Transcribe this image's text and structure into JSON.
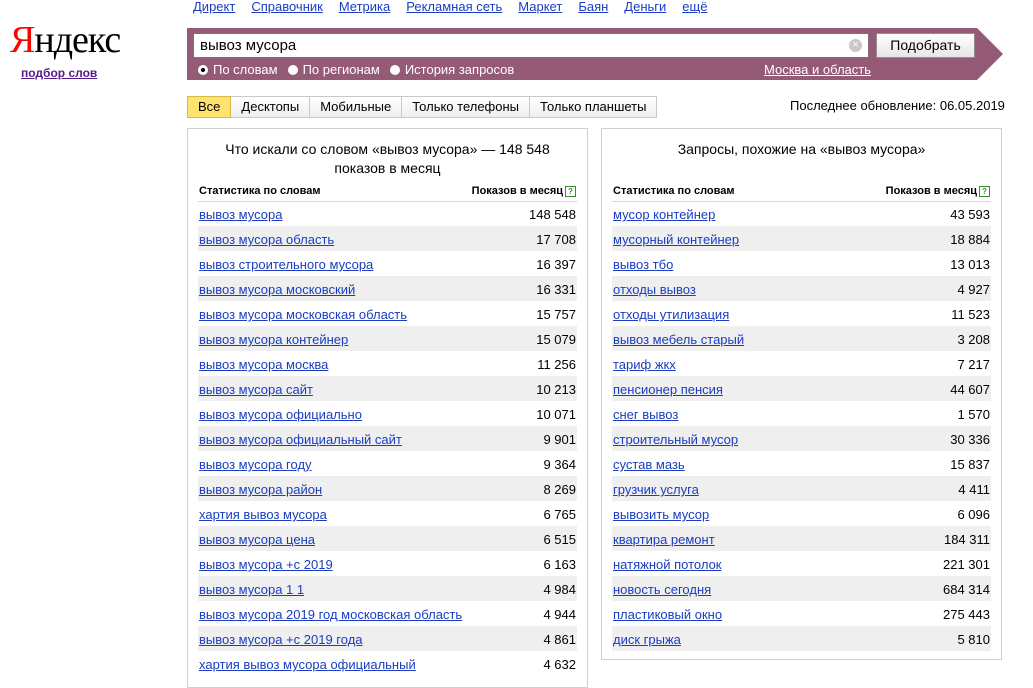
{
  "logo": {
    "first": "Я",
    "rest": "ндекс",
    "sub": "подбор слов"
  },
  "topnav": [
    "Директ",
    "Справочник",
    "Метрика",
    "Рекламная сеть",
    "Маркет",
    "Баян",
    "Деньги",
    "ещё"
  ],
  "search": {
    "value": "вывоз мусора",
    "button": "Подобрать",
    "clear_icon": "×"
  },
  "radios": [
    {
      "label": "По словам",
      "checked": true
    },
    {
      "label": "По регионам",
      "checked": false
    },
    {
      "label": "История запросов",
      "checked": false
    }
  ],
  "region": "Москва и область",
  "tabs": [
    "Все",
    "Десктопы",
    "Мобильные",
    "Только телефоны",
    "Только планшеты"
  ],
  "updated": "Последнее обновление: 06.05.2019",
  "left": {
    "title": "Что искали со словом «вывоз мусора» — 148 548 показов в месяц",
    "col1": "Статистика по словам",
    "col2": "Показов в месяц",
    "help": "?",
    "rows": [
      {
        "kw": "вывоз мусора",
        "n": "148 548"
      },
      {
        "kw": "вывоз мусора область",
        "n": "17 708"
      },
      {
        "kw": "вывоз строительного мусора",
        "n": "16 397"
      },
      {
        "kw": "вывоз мусора московский",
        "n": "16 331"
      },
      {
        "kw": "вывоз мусора московская область",
        "n": "15 757"
      },
      {
        "kw": "вывоз мусора контейнер",
        "n": "15 079"
      },
      {
        "kw": "вывоз мусора москва",
        "n": "11 256"
      },
      {
        "kw": "вывоз мусора сайт",
        "n": "10 213"
      },
      {
        "kw": "вывоз мусора официально",
        "n": "10 071"
      },
      {
        "kw": "вывоз мусора официальный сайт",
        "n": "9 901"
      },
      {
        "kw": "вывоз мусора году",
        "n": "9 364"
      },
      {
        "kw": "вывоз мусора район",
        "n": "8 269"
      },
      {
        "kw": "хартия вывоз мусора",
        "n": "6 765"
      },
      {
        "kw": "вывоз мусора цена",
        "n": "6 515"
      },
      {
        "kw": "вывоз мусора +с 2019",
        "n": "6 163"
      },
      {
        "kw": "вывоз мусора 1 1",
        "n": "4 984"
      },
      {
        "kw": "вывоз мусора 2019 год московская область",
        "n": "4 944"
      },
      {
        "kw": "вывоз мусора +с 2019 года",
        "n": "4 861"
      },
      {
        "kw": "хартия вывоз мусора официальный",
        "n": "4 632"
      }
    ]
  },
  "right": {
    "title": "Запросы, похожие на «вывоз мусора»",
    "col1": "Статистика по словам",
    "col2": "Показов в месяц",
    "help": "?",
    "rows": [
      {
        "kw": "мусор контейнер",
        "n": "43 593"
      },
      {
        "kw": "мусорный контейнер",
        "n": "18 884"
      },
      {
        "kw": "вывоз тбо",
        "n": "13 013"
      },
      {
        "kw": "отходы вывоз",
        "n": "4 927"
      },
      {
        "kw": "отходы утилизация",
        "n": "11 523"
      },
      {
        "kw": "вывоз мебель старый",
        "n": "3 208"
      },
      {
        "kw": "тариф жкх",
        "n": "7 217"
      },
      {
        "kw": "пенсионер пенсия",
        "n": "44 607"
      },
      {
        "kw": "снег вывоз",
        "n": "1 570"
      },
      {
        "kw": "строительный мусор",
        "n": "30 336"
      },
      {
        "kw": "сустав мазь",
        "n": "15 837"
      },
      {
        "kw": "грузчик услуга",
        "n": "4 411"
      },
      {
        "kw": "вывозить мусор",
        "n": "6 096"
      },
      {
        "kw": "квартира ремонт",
        "n": "184 311"
      },
      {
        "kw": "натяжной потолок",
        "n": "221 301"
      },
      {
        "kw": "новость сегодня",
        "n": "684 314"
      },
      {
        "kw": "пластиковый окно",
        "n": "275 443"
      },
      {
        "kw": "диск грыжа",
        "n": "5 810"
      }
    ]
  }
}
